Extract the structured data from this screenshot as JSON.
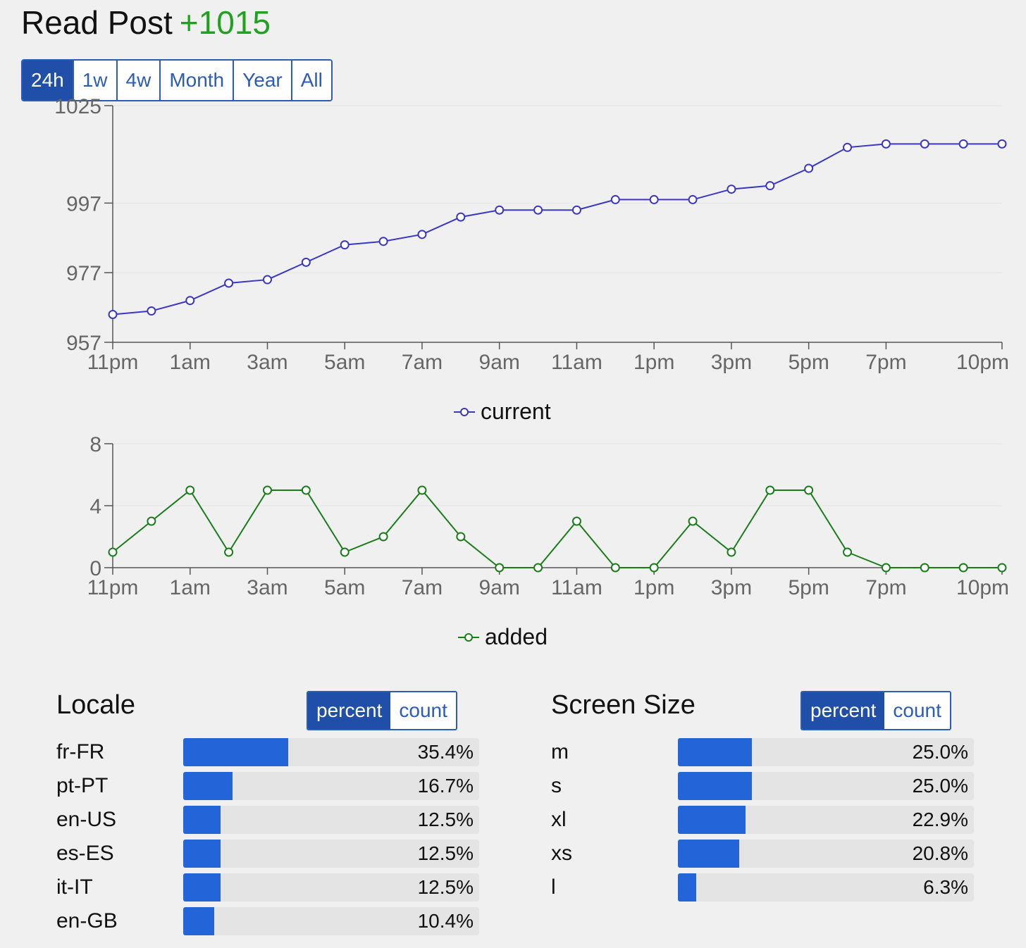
{
  "title": "Read Post",
  "delta": "+1015",
  "range_tabs": [
    "24h",
    "1w",
    "4w",
    "Month",
    "Year",
    "All"
  ],
  "active_range": "24h",
  "colors": {
    "current": "#3a36c7",
    "added": "#1a7d1a",
    "bar": "#2464d9",
    "accent": "#1f4fa8"
  },
  "chart_data": [
    {
      "type": "line",
      "series": [
        {
          "name": "current",
          "values": [
            965,
            966,
            969,
            974,
            975,
            980,
            985,
            986,
            988,
            993,
            995,
            995,
            995,
            998,
            998,
            998,
            1001,
            1002,
            1007,
            1013,
            1014,
            1014,
            1014,
            1014
          ]
        }
      ],
      "x_tick_labels": [
        "11pm",
        "1am",
        "3am",
        "5am",
        "7am",
        "9am",
        "11am",
        "1pm",
        "3pm",
        "5pm",
        "7pm",
        "10pm"
      ],
      "y_ticks": [
        957,
        977,
        997,
        1025
      ],
      "ylim": [
        957,
        1025
      ],
      "legend": "bottom-center"
    },
    {
      "type": "line",
      "series": [
        {
          "name": "added",
          "values": [
            1,
            3,
            5,
            1,
            5,
            5,
            1,
            2,
            5,
            2,
            0,
            0,
            3,
            0,
            0,
            3,
            1,
            5,
            5,
            1,
            0,
            0,
            0,
            0
          ]
        }
      ],
      "x_tick_labels": [
        "11pm",
        "1am",
        "3am",
        "5am",
        "7am",
        "9am",
        "11am",
        "1pm",
        "3pm",
        "5pm",
        "7pm",
        "10pm"
      ],
      "y_ticks": [
        0,
        4,
        8
      ],
      "ylim": [
        0,
        8
      ],
      "legend": "bottom-center"
    }
  ],
  "locale": {
    "title": "Locale",
    "toggle": [
      "percent",
      "count"
    ],
    "active": "percent",
    "rows": [
      {
        "label": "fr-FR",
        "value": "35.4%",
        "pct": 35.4
      },
      {
        "label": "pt-PT",
        "value": "16.7%",
        "pct": 16.7
      },
      {
        "label": "en-US",
        "value": "12.5%",
        "pct": 12.5
      },
      {
        "label": "es-ES",
        "value": "12.5%",
        "pct": 12.5
      },
      {
        "label": "it-IT",
        "value": "12.5%",
        "pct": 12.5
      },
      {
        "label": "en-GB",
        "value": "10.4%",
        "pct": 10.4
      }
    ]
  },
  "screen_size": {
    "title": "Screen Size",
    "toggle": [
      "percent",
      "count"
    ],
    "active": "percent",
    "rows": [
      {
        "label": "m",
        "value": "25.0%",
        "pct": 25.0
      },
      {
        "label": "s",
        "value": "25.0%",
        "pct": 25.0
      },
      {
        "label": "xl",
        "value": "22.9%",
        "pct": 22.9
      },
      {
        "label": "xs",
        "value": "20.8%",
        "pct": 20.8
      },
      {
        "label": "l",
        "value": "6.3%",
        "pct": 6.3
      }
    ]
  }
}
